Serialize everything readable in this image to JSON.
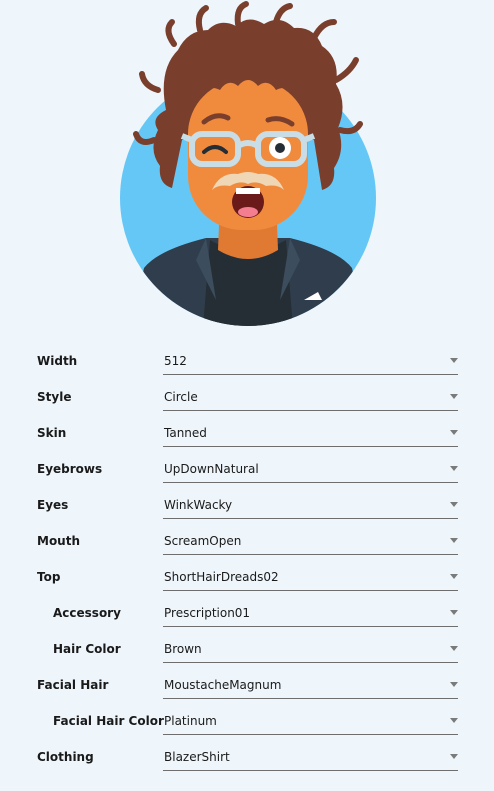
{
  "avatar": {
    "background_color": "#65c7f6",
    "skin_color": "#f08b3e",
    "hair_color": "#7a3e2c",
    "glasses_color": "#c9dde6",
    "moustache_color": "#efd6b5",
    "jacket_color": "#2f3d4c",
    "shirt_color": "#262e35"
  },
  "form": {
    "rows": [
      {
        "label": "Width",
        "value": "512"
      },
      {
        "label": "Style",
        "value": "Circle"
      },
      {
        "label": "Skin",
        "value": "Tanned"
      },
      {
        "label": "Eyebrows",
        "value": "UpDownNatural"
      },
      {
        "label": "Eyes",
        "value": "WinkWacky"
      },
      {
        "label": "Mouth",
        "value": "ScreamOpen"
      },
      {
        "label": "Top",
        "value": "ShortHairDreads02"
      },
      {
        "label": "Accessory",
        "value": "Prescription01"
      },
      {
        "label": "Hair Color",
        "value": "Brown"
      },
      {
        "label": "Facial Hair",
        "value": "MoustacheMagnum"
      },
      {
        "label": "Facial Hair Color",
        "value": "Platinum"
      },
      {
        "label": "Clothing",
        "value": "BlazerShirt"
      }
    ]
  }
}
